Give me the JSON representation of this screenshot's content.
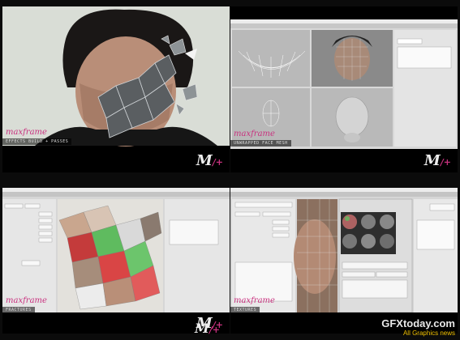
{
  "brand": "maxframe",
  "logo": {
    "main": "M",
    "sub": "/+"
  },
  "captions": {
    "q1": "EFFECTS BUILD + PASSES",
    "q2": "UNWRAPPED FACE MESH",
    "q3": "FRACTURES",
    "q4": "TEXTURES"
  },
  "watermark": {
    "site": "GFXtoday.com",
    "tagline": "All Graphics news"
  }
}
